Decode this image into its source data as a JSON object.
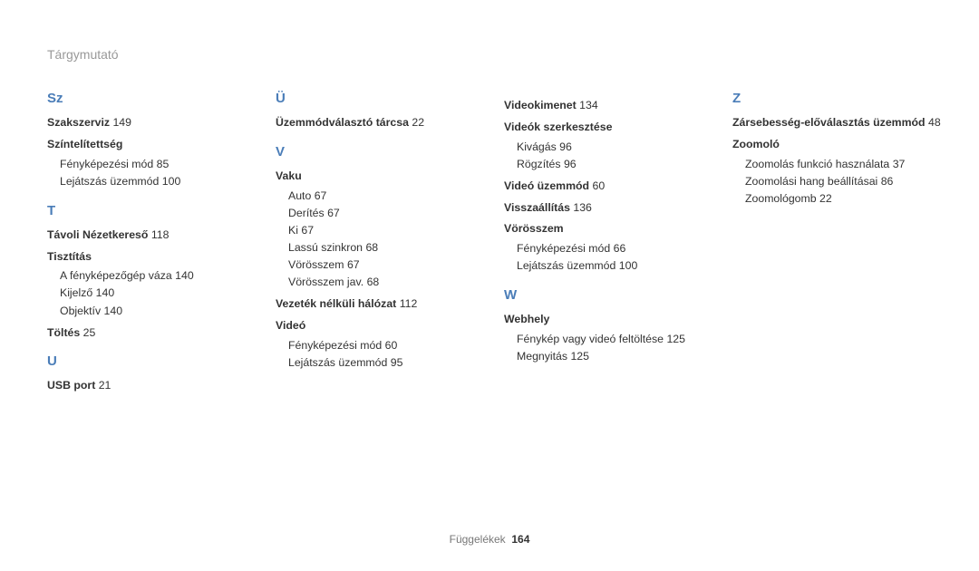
{
  "header": "Tárgymutató",
  "footer": {
    "label": "Függelékek",
    "page": "164"
  },
  "cols": [
    {
      "groups": [
        {
          "letter": "Sz",
          "items": [
            {
              "label": "Szakszerviz",
              "page": "149"
            },
            {
              "label": "Színtelítettség",
              "subs": [
                {
                  "label": "Fényképezési mód",
                  "page": "85"
                },
                {
                  "label": "Lejátszás üzemmód",
                  "page": "100"
                }
              ]
            }
          ]
        },
        {
          "letter": "T",
          "items": [
            {
              "label": "Távoli Nézetkereső",
              "page": "118"
            },
            {
              "label": "Tisztítás",
              "subs": [
                {
                  "label": "A fényképezőgép váza",
                  "page": "140"
                },
                {
                  "label": "Kijelző",
                  "page": "140"
                },
                {
                  "label": "Objektív",
                  "page": "140"
                }
              ]
            },
            {
              "label": "Töltés",
              "page": "25"
            }
          ]
        },
        {
          "letter": "U",
          "items": [
            {
              "label": "USB port",
              "page": "21"
            }
          ]
        }
      ]
    },
    {
      "groups": [
        {
          "letter": "Ü",
          "items": [
            {
              "label": "Üzemmódválasztó tárcsa",
              "page": "22"
            }
          ]
        },
        {
          "letter": "V",
          "items": [
            {
              "label": "Vaku",
              "subs": [
                {
                  "label": "Auto",
                  "page": "67"
                },
                {
                  "label": "Derítés",
                  "page": "67"
                },
                {
                  "label": "Ki",
                  "page": "67"
                },
                {
                  "label": "Lassú szinkron",
                  "page": "68"
                },
                {
                  "label": "Vörösszem",
                  "page": "67"
                },
                {
                  "label": "Vörösszem jav.",
                  "page": "68"
                }
              ]
            },
            {
              "label": "Vezeték nélküli hálózat",
              "page": "112"
            },
            {
              "label": "Videó",
              "subs": [
                {
                  "label": "Fényképezési mód",
                  "page": "60"
                },
                {
                  "label": "Lejátszás üzemmód",
                  "page": "95"
                }
              ]
            }
          ]
        }
      ]
    },
    {
      "groups": [
        {
          "letter": "",
          "items": [
            {
              "label": "Videokimenet",
              "page": "134"
            },
            {
              "label": "Videók szerkesztése",
              "subs": [
                {
                  "label": "Kivágás",
                  "page": "96"
                },
                {
                  "label": "Rögzítés",
                  "page": "96"
                }
              ]
            },
            {
              "label": "Videó üzemmód",
              "page": "60"
            },
            {
              "label": "Visszaállítás",
              "page": "136"
            },
            {
              "label": "Vörösszem",
              "subs": [
                {
                  "label": "Fényképezési mód",
                  "page": "66"
                },
                {
                  "label": "Lejátszás üzemmód",
                  "page": "100"
                }
              ]
            }
          ]
        },
        {
          "letter": "W",
          "items": [
            {
              "label": "Webhely",
              "subs": [
                {
                  "label": "Fénykép vagy videó feltöltése",
                  "page": "125"
                },
                {
                  "label": "Megnyitás",
                  "page": "125"
                }
              ]
            }
          ]
        }
      ]
    },
    {
      "groups": [
        {
          "letter": "Z",
          "items": [
            {
              "label": "Zársebesség-előválasztás üzemmód",
              "page": "48"
            },
            {
              "label": "Zoomoló",
              "subs": [
                {
                  "label": "Zoomolás funkció használata",
                  "page": "37"
                },
                {
                  "label": "Zoomolási hang beállításai",
                  "page": "86"
                },
                {
                  "label": "Zoomológomb",
                  "page": "22"
                }
              ]
            }
          ]
        }
      ]
    }
  ]
}
